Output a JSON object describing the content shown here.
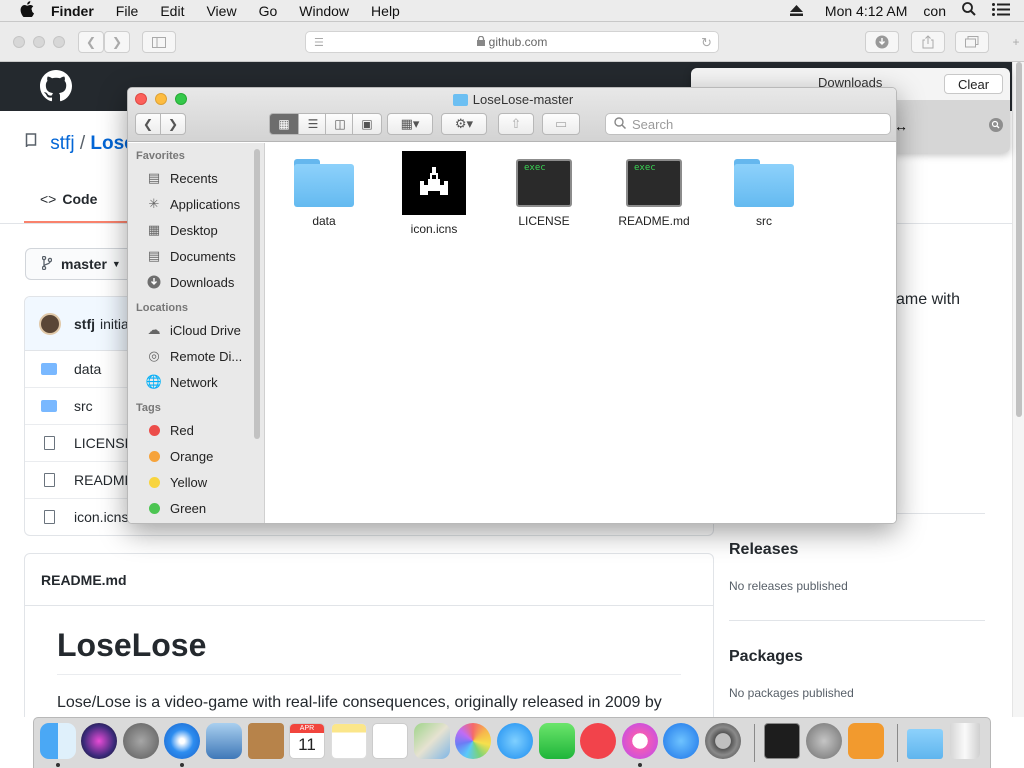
{
  "menubar": {
    "app": "Finder",
    "items": [
      "File",
      "Edit",
      "View",
      "Go",
      "Window",
      "Help"
    ],
    "clock": "Mon 4:12 AM",
    "user": "con"
  },
  "browser": {
    "url": "github.com"
  },
  "downloads": {
    "title": "Downloads",
    "clear_label": "Clear"
  },
  "github": {
    "owner": "stfj",
    "repo": "Lose",
    "code_tab": "Code",
    "branch": "master",
    "commit_author": "stfj",
    "commit_message": "initia",
    "files": [
      {
        "name": "data",
        "kind": "folder"
      },
      {
        "name": "src",
        "kind": "folder"
      },
      {
        "name": "LICENSE",
        "kind": "file"
      },
      {
        "name": "README",
        "kind": "file"
      },
      {
        "name": "icon.icns",
        "kind": "file"
      }
    ],
    "readme_header": "README.md",
    "readme_title": "LoseLose",
    "readme_text": "Lose/Lose is a video-game with real-life consequences, originally released in 2009 by",
    "about_fragment": "ame with",
    "releases_title": "Releases",
    "releases_text": "No releases published",
    "packages_title": "Packages",
    "packages_text": "No packages published"
  },
  "finder": {
    "title": "LoseLose-master",
    "search_placeholder": "Search",
    "sidebar": {
      "favorites_label": "Favorites",
      "favorites": [
        {
          "label": "Recents",
          "icon": "recents-icon"
        },
        {
          "label": "Applications",
          "icon": "applications-icon"
        },
        {
          "label": "Desktop",
          "icon": "desktop-icon"
        },
        {
          "label": "Documents",
          "icon": "documents-icon"
        },
        {
          "label": "Downloads",
          "icon": "downloads-icon"
        }
      ],
      "locations_label": "Locations",
      "locations": [
        {
          "label": "iCloud Drive",
          "icon": "icloud-icon"
        },
        {
          "label": "Remote Di...",
          "icon": "remote-disc-icon"
        },
        {
          "label": "Network",
          "icon": "network-icon"
        }
      ],
      "tags_label": "Tags",
      "tags": [
        {
          "label": "Red",
          "color": "#ec4d4a"
        },
        {
          "label": "Orange",
          "color": "#f6a33b"
        },
        {
          "label": "Yellow",
          "color": "#f8d43e"
        },
        {
          "label": "Green",
          "color": "#4cc552"
        }
      ]
    },
    "items": [
      {
        "name": "data",
        "kind": "folder"
      },
      {
        "name": "icon.icns",
        "kind": "icns"
      },
      {
        "name": "LICENSE",
        "kind": "exec"
      },
      {
        "name": "README.md",
        "kind": "exec"
      },
      {
        "name": "src",
        "kind": "folder"
      }
    ],
    "exec_label": "exec"
  },
  "dock": {
    "apps": [
      "finder",
      "siri",
      "launchpad",
      "safari",
      "mail",
      "contacts",
      "calendar",
      "notes",
      "reminders",
      "maps",
      "photos",
      "messages",
      "facetime",
      "news",
      "itunes",
      "app-store",
      "system-preferences",
      "activity-monitor",
      "automator",
      "home",
      "folder",
      "trash"
    ],
    "calendar_month": "APR",
    "calendar_day": "11"
  }
}
